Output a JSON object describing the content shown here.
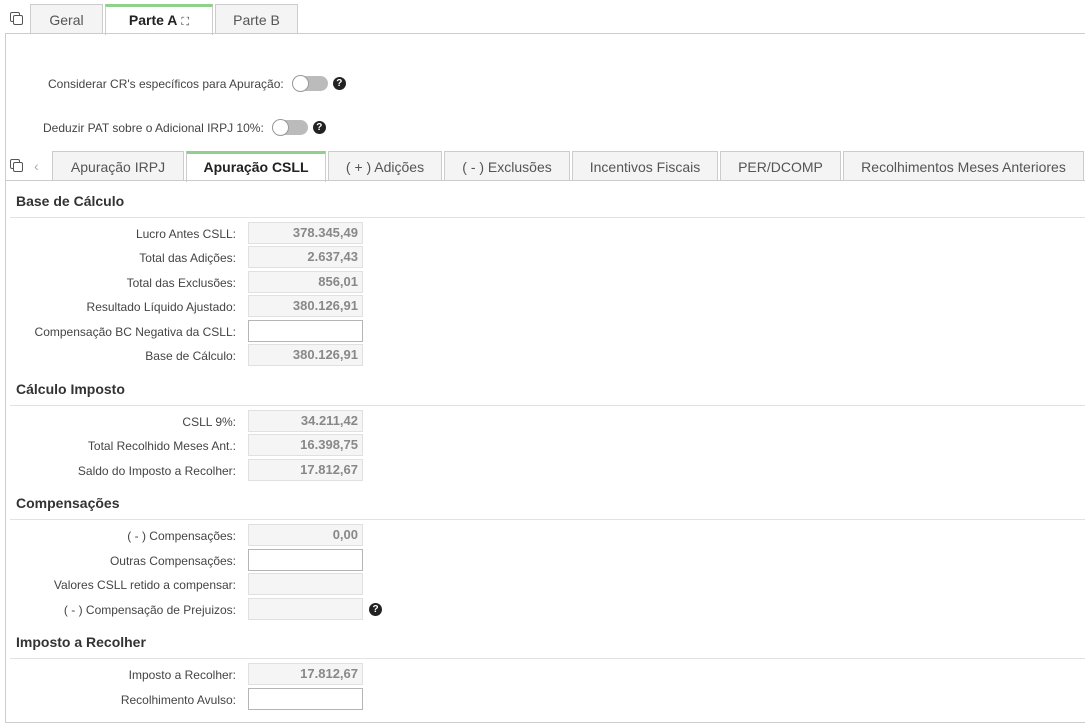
{
  "top_tabs": [
    "Geral",
    "Parte A",
    "Parte B"
  ],
  "toggles": {
    "cr_label": "Considerar CR's específicos para Apuração:",
    "pat_label": "Deduzir PAT sobre o Adicional IRPJ 10%:"
  },
  "inner_tabs": [
    "Apuração IRPJ",
    "Apuração CSLL",
    "( + ) Adições",
    "( - ) Exclusões",
    "Incentivos Fiscais",
    "PER/DCOMP",
    "Recolhimentos Meses Anteriores"
  ],
  "base": {
    "title": "Base de Cálculo",
    "lucro_label": "Lucro Antes CSLL:",
    "lucro_value": "378.345,49",
    "adicoes_label": "Total das Adições:",
    "adicoes_value": "2.637,43",
    "exclusoes_label": "Total das Exclusões:",
    "exclusoes_value": "856,01",
    "resultado_label": "Resultado Líquido Ajustado:",
    "resultado_value": "380.126,91",
    "compensacao_label": "Compensação BC Negativa da CSLL:",
    "compensacao_value": "",
    "base_label": "Base de Cálculo:",
    "base_value": "380.126,91"
  },
  "calculo": {
    "title": "Cálculo Imposto",
    "csll_label": "CSLL 9%:",
    "csll_value": "34.211,42",
    "recolhido_label": "Total Recolhido Meses Ant.:",
    "recolhido_value": "16.398,75",
    "saldo_label": "Saldo do Imposto a Recolher:",
    "saldo_value": "17.812,67"
  },
  "compensacoes": {
    "title": "Compensações",
    "comp_label": "( - ) Compensações:",
    "comp_value": "0,00",
    "outras_label": "Outras Compensações:",
    "outras_value": "",
    "retido_label": "Valores CSLL retido a compensar:",
    "retido_value": "",
    "prejuizos_label": "( - ) Compensação de Prejuizos:",
    "prejuizos_value": ""
  },
  "imposto": {
    "title": "Imposto a Recolher",
    "recolher_label": "Imposto a Recolher:",
    "recolher_value": "17.812,67",
    "avulso_label": "Recolhimento Avulso:",
    "avulso_value": ""
  }
}
